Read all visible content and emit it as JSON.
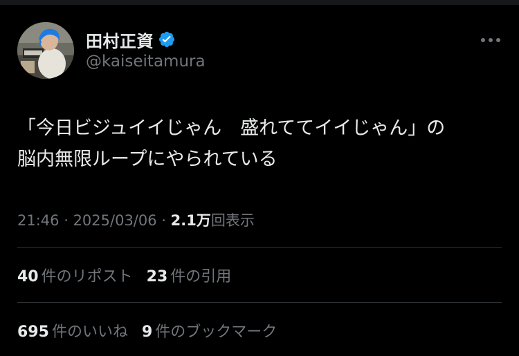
{
  "author": {
    "name": "田村正資",
    "handle": "@kaiseitamura",
    "verified_color": "#1d9bf0"
  },
  "tweet": {
    "text_line1": "「今日ビジュイイじゃん　盛れててイイじゃん」の",
    "text_line2": "脳内無限ループにやられている"
  },
  "meta": {
    "time": "21:46",
    "separator": " · ",
    "date": "2025/03/06",
    "views_count": "2.1万",
    "views_label": "回表示"
  },
  "stats": {
    "reposts_count": "40",
    "reposts_label": "件のリポスト",
    "quotes_count": "23",
    "quotes_label": "件の引用",
    "likes_count": "695",
    "likes_label": "件のいいね",
    "bookmarks_count": "9",
    "bookmarks_label": "件のブックマーク"
  },
  "icons": {
    "more": "more-horizontal-icon",
    "verified": "verified-badge-icon"
  }
}
